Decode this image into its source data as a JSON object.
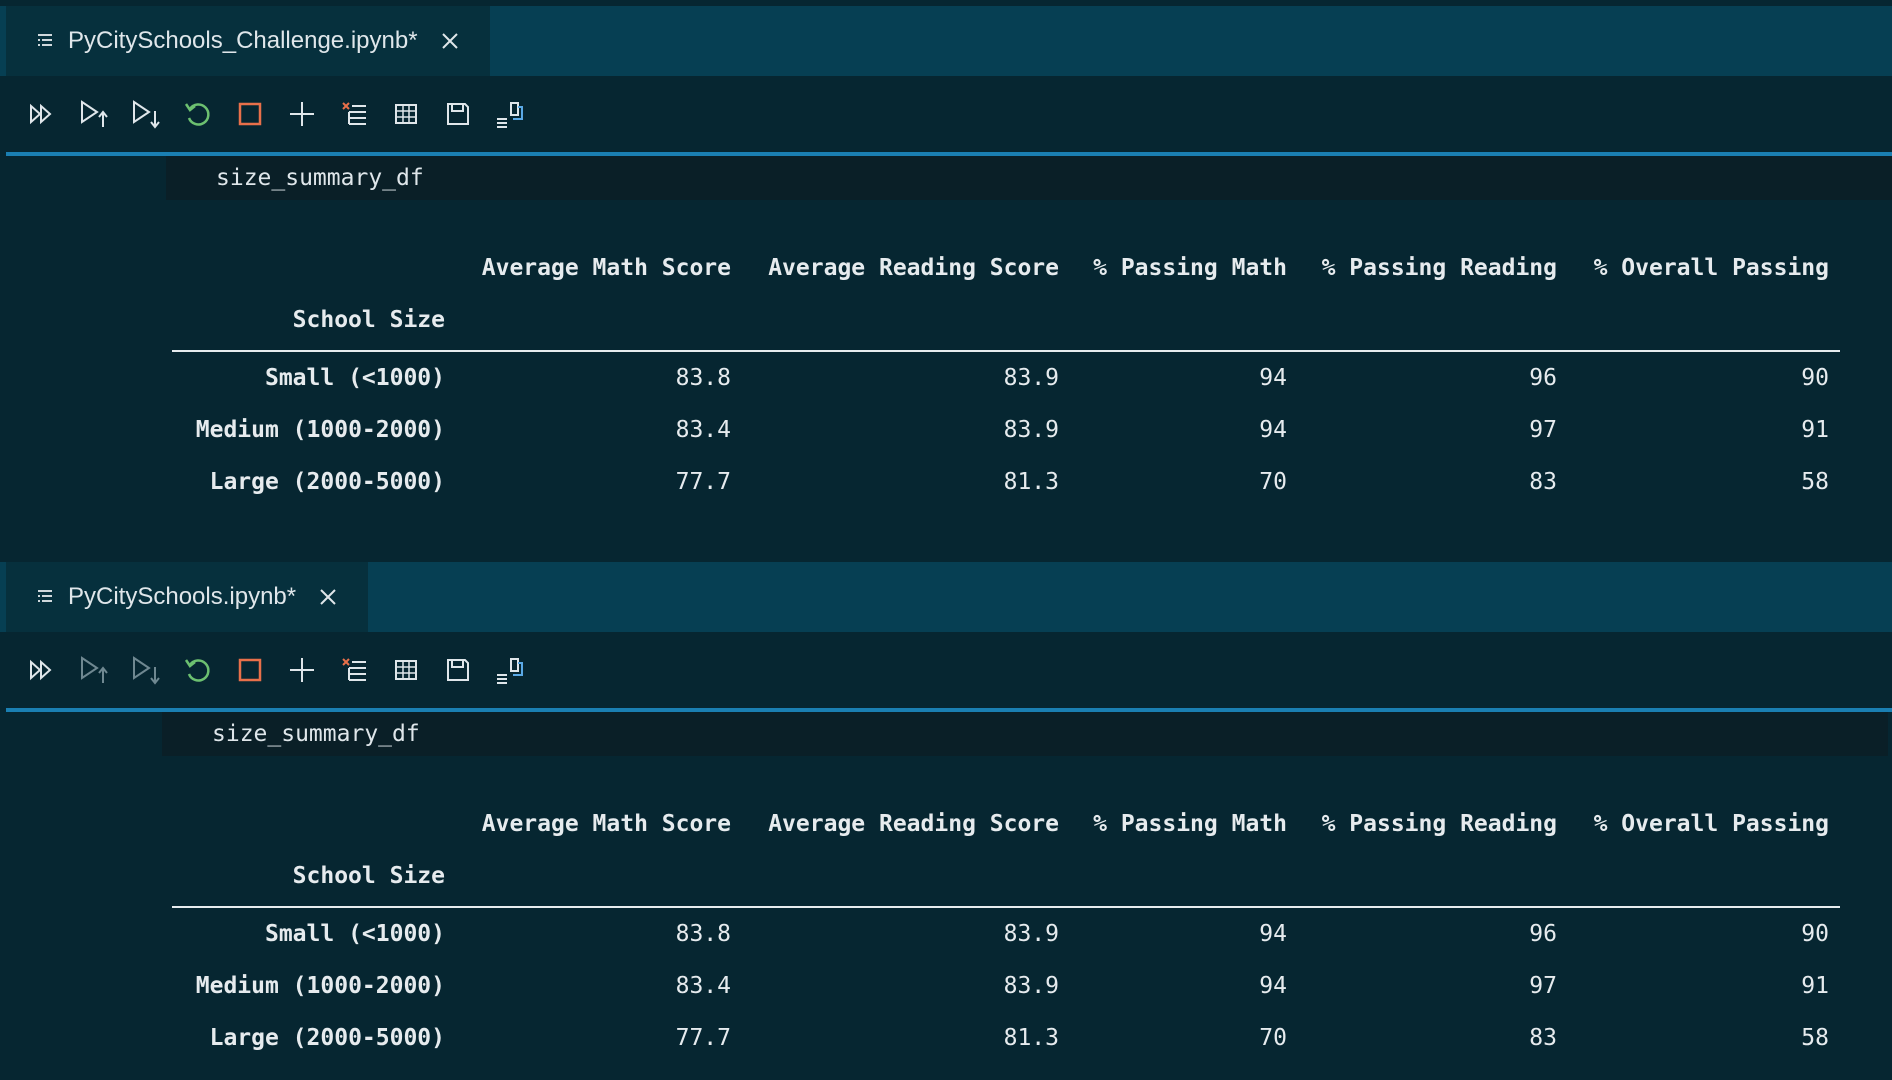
{
  "panes": [
    {
      "tab_title": "PyCitySchools_Challenge.ipynb*",
      "code": "size_summary_df",
      "table": {
        "columns": [
          "Average Math Score",
          "Average Reading Score",
          "% Passing Math",
          "% Passing Reading",
          "% Overall Passing"
        ],
        "index_name": "School Size",
        "rows": [
          {
            "label": "Small (<1000)",
            "values": [
              "83.8",
              "83.9",
              "94",
              "96",
              "90"
            ]
          },
          {
            "label": "Medium (1000-2000)",
            "values": [
              "83.4",
              "83.9",
              "94",
              "97",
              "91"
            ]
          },
          {
            "label": "Large (2000-5000)",
            "values": [
              "77.7",
              "81.3",
              "70",
              "83",
              "58"
            ]
          }
        ]
      }
    },
    {
      "tab_title": "PyCitySchools.ipynb*",
      "code": "size_summary_df",
      "table": {
        "columns": [
          "Average Math Score",
          "Average Reading Score",
          "% Passing Math",
          "% Passing Reading",
          "% Overall Passing"
        ],
        "index_name": "School Size",
        "rows": [
          {
            "label": "Small (<1000)",
            "values": [
              "83.8",
              "83.9",
              "94",
              "96",
              "90"
            ]
          },
          {
            "label": "Medium (1000-2000)",
            "values": [
              "83.4",
              "83.9",
              "94",
              "97",
              "91"
            ]
          },
          {
            "label": "Large (2000-5000)",
            "values": [
              "77.7",
              "81.3",
              "70",
              "83",
              "58"
            ]
          }
        ]
      }
    }
  ],
  "toolbar_icons": [
    "run-all-icon",
    "run-above-icon",
    "run-below-icon",
    "restart-kernel-icon",
    "interrupt-kernel-icon",
    "add-cell-icon",
    "clear-outputs-icon",
    "variables-icon",
    "save-icon",
    "export-icon"
  ],
  "colors": {
    "background": "#062631",
    "tab_strip": "#063f53",
    "active_tab": "#06303d",
    "accent_line": "#1a7fb2",
    "restart_green": "#6cc070",
    "interrupt_orange": "#e8704a",
    "text": "#dfe6ea"
  }
}
